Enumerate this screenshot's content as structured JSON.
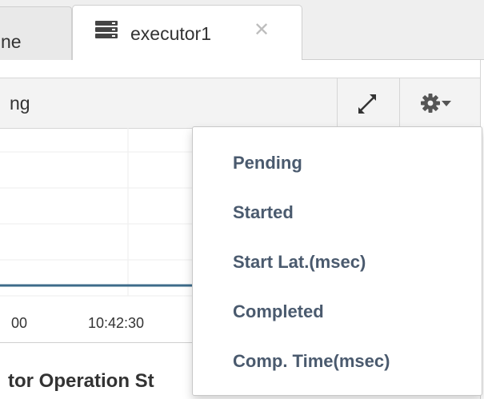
{
  "tabs": {
    "previous_label": "ne",
    "active_label": "executor1",
    "close_glyph": "✕",
    "active_icon": "server-icon"
  },
  "panel": {
    "title": "ng",
    "expand_icon": "expand-icon",
    "settings_icon": "gear-icon",
    "settings_caret": "caret-down-icon"
  },
  "chart": {
    "x_ticks": [
      {
        "label": "00"
      },
      {
        "label": "10:42:30"
      }
    ],
    "line_color": "#3d6b8a"
  },
  "section": {
    "title": "tor Operation St"
  },
  "menu": {
    "items": [
      {
        "label": "Pending"
      },
      {
        "label": "Started"
      },
      {
        "label": "Start Lat.(msec)"
      },
      {
        "label": "Completed"
      },
      {
        "label": "Comp. Time(msec)"
      }
    ]
  },
  "colors": {
    "menu_text": "#4a5a6e",
    "tab_bar": "#efefef",
    "header_bg": "#f3f3f3",
    "icon_gray": "#555555"
  }
}
